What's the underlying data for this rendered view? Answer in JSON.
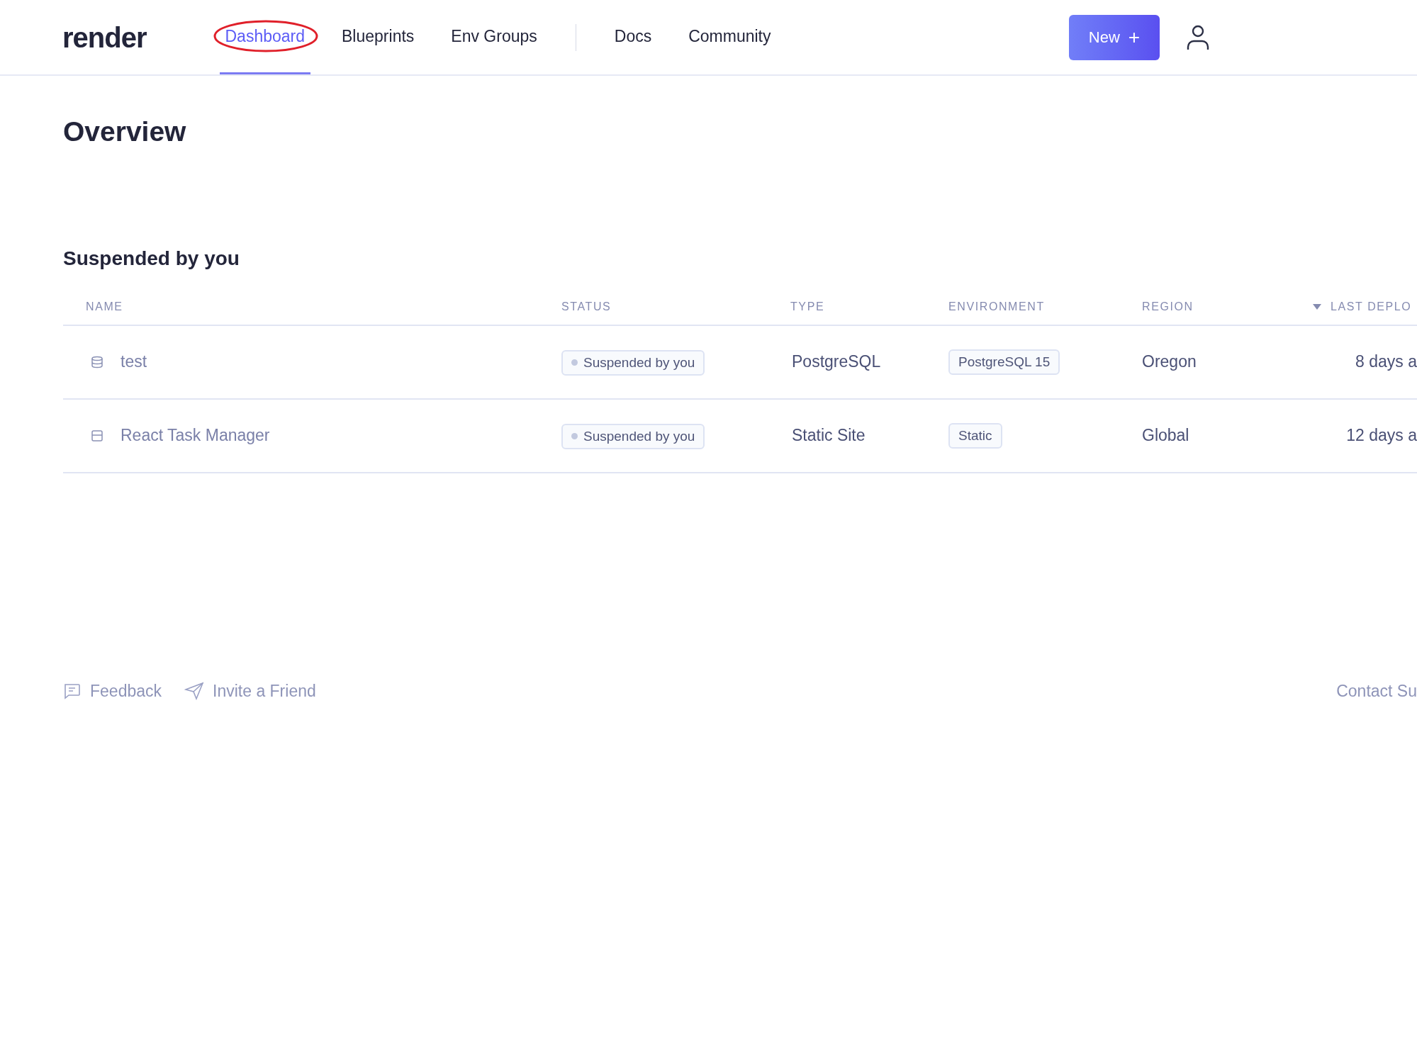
{
  "logo": "render",
  "nav": [
    {
      "label": "Dashboard",
      "selected": true,
      "circled": true
    },
    {
      "label": "Blueprints",
      "selected": false,
      "circled": false
    },
    {
      "label": "Env Groups",
      "selected": false,
      "circled": false
    },
    {
      "label": "Docs",
      "selected": false,
      "circled": false
    },
    {
      "label": "Community",
      "selected": false,
      "circled": false
    }
  ],
  "new_button": {
    "label": "New",
    "icon": "+"
  },
  "page_title": "Overview",
  "section_title": "Suspended by you",
  "table": {
    "columns": [
      {
        "label": "NAME",
        "sorted": false
      },
      {
        "label": "STATUS",
        "sorted": false
      },
      {
        "label": "TYPE",
        "sorted": false
      },
      {
        "label": "ENVIRONMENT",
        "sorted": false
      },
      {
        "label": "REGION",
        "sorted": false
      },
      {
        "label": "LAST DEPLO",
        "sorted": true
      }
    ],
    "rows": [
      {
        "kind": "database",
        "name": "test",
        "status": "Suspended by you",
        "type": "PostgreSQL",
        "environment": "PostgreSQL 15",
        "region": "Oregon",
        "last_deploy": "8 days a"
      },
      {
        "kind": "static",
        "name": "React Task Manager",
        "status": "Suspended by you",
        "type": "Static Site",
        "environment": "Static",
        "region": "Global",
        "last_deploy": "12 days a"
      }
    ]
  },
  "footer": {
    "links": [
      {
        "kind": "feedback",
        "label": "Feedback"
      },
      {
        "kind": "invite",
        "label": "Invite a Friend"
      }
    ],
    "contact": "Contact Su"
  }
}
